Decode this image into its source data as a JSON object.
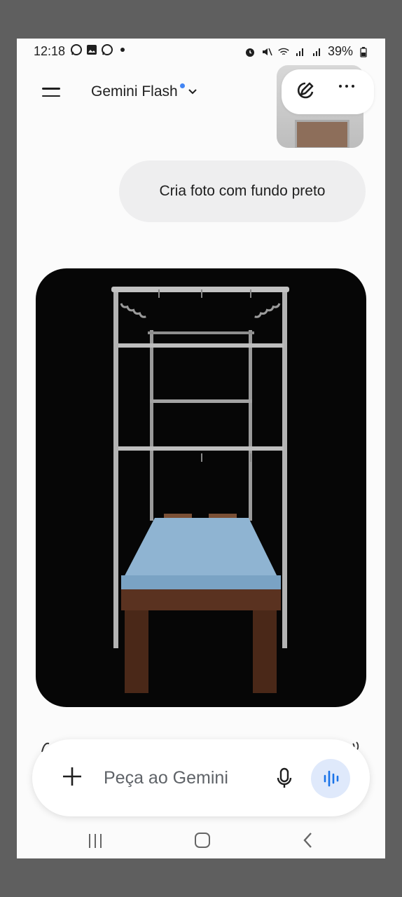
{
  "status_bar": {
    "time": "12:18",
    "battery": "39%"
  },
  "header": {
    "title": "Gemini Flash"
  },
  "chat": {
    "user_message": "Cria foto com fundo preto"
  },
  "composer": {
    "placeholder": "Peça ao Gemini"
  },
  "icons": [
    "menu-icon",
    "chevron-down-icon",
    "edit-icon",
    "more-icon",
    "plus-icon",
    "mic-icon",
    "live-icon",
    "nav-recent-icon",
    "nav-home-icon",
    "nav-back-icon"
  ],
  "colors": {
    "background": "#fbfbfb",
    "bubble": "#eeeeef",
    "accent": "#4285f4",
    "live_button": "#dfe9fb",
    "image_background": "#060606"
  }
}
